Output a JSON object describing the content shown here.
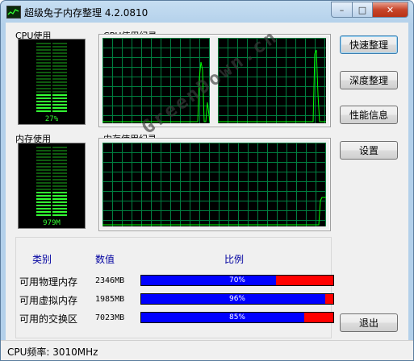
{
  "window": {
    "title": "超级兔子内存整理 4.2.0810",
    "controls": {
      "minimize": "–",
      "maximize": "□",
      "close": "✕"
    }
  },
  "cpu": {
    "label": "CPU使用",
    "percent_text": "27%",
    "usage": 0.27,
    "history_label": "CPU使用纪录"
  },
  "memory": {
    "label": "内存使用",
    "value_text": "979M",
    "history_label": "内存使用纪录"
  },
  "buttons": {
    "fast": "快速整理",
    "deep": "深度整理",
    "info": "性能信息",
    "settings": "设置",
    "exit": "退出"
  },
  "table": {
    "headers": {
      "category": "类别",
      "value": "数值",
      "ratio": "比例"
    },
    "rows": [
      {
        "label": "可用物理内存",
        "value": "2346MB",
        "percent_text": "70%",
        "percent": 70
      },
      {
        "label": "可用虚拟内存",
        "value": "1985MB",
        "percent_text": "96%",
        "percent": 96
      },
      {
        "label": "可用的交换区",
        "value": "7023MB",
        "percent_text": "85%",
        "percent": 85
      }
    ]
  },
  "status": {
    "text": "CPU频率: 3010MHz"
  },
  "watermark": {
    "text": "GreenDown.cn"
  },
  "colors": {
    "meter_on": "#33ff33",
    "meter_off": "#0f5a0f",
    "grid": "#008040",
    "trace": "#00ff00",
    "bar_used": "#0000ff",
    "bar_rest": "#ff0000"
  }
}
